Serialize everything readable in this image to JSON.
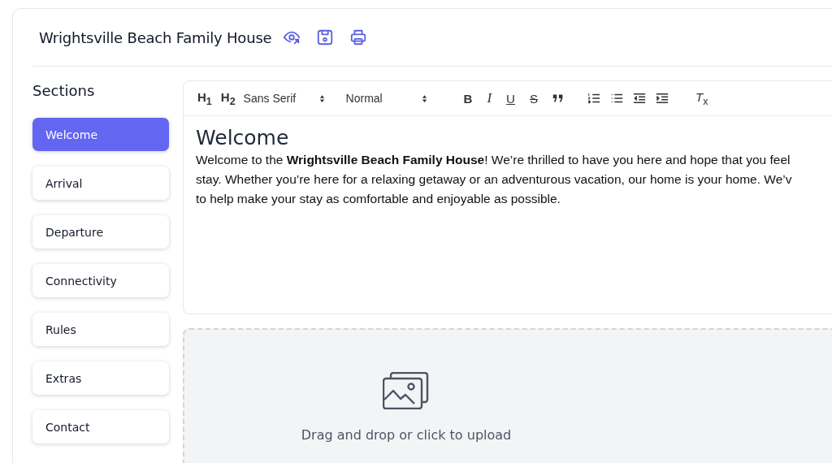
{
  "title": "Wrightsville Beach Family House",
  "sections": {
    "heading": "Sections",
    "items": [
      {
        "label": "Welcome",
        "selected": true
      },
      {
        "label": "Arrival",
        "selected": false
      },
      {
        "label": "Departure",
        "selected": false
      },
      {
        "label": "Connectivity",
        "selected": false
      },
      {
        "label": "Rules",
        "selected": false
      },
      {
        "label": "Extras",
        "selected": false
      },
      {
        "label": "Contact",
        "selected": false
      }
    ]
  },
  "toolbar": [
    {
      "kind": "text",
      "label": "H$_{1}$"
    },
    {
      "kind": "text",
      "label": "H$_{2}$"
    },
    {
      "kind": "select",
      "label": "Sans Serif"
    },
    {
      "kind": "select",
      "label": "Normal"
    },
    {
      "kind": "bold",
      "label": "B"
    },
    {
      "kind": "italic",
      "label": "I"
    },
    {
      "kind": "underline",
      "label": "U"
    },
    {
      "kind": "strike",
      "label": "S"
    },
    {
      "kind": "quote"
    },
    {
      "kind": "ordered"
    },
    {
      "kind": "bullet"
    },
    {
      "kind": "outdent"
    },
    {
      "kind": "indent"
    },
    {
      "kind": "clean",
      "label": "*T*$_{x}$"
    }
  ],
  "editor": {
    "heading": "Welcome",
    "lines": [
      "Welcome to the **Wrightsville Beach Family House**! We’re thrilled to have you here and hope that you feel",
      "stay. Whether you’re here for a relaxing getaway or an adventurous vacation, our home is your home. We’v",
      "to help make your stay as comfortable and enjoyable as possible."
    ]
  },
  "upload": {
    "text": "Drag and drop or click to upload"
  }
}
